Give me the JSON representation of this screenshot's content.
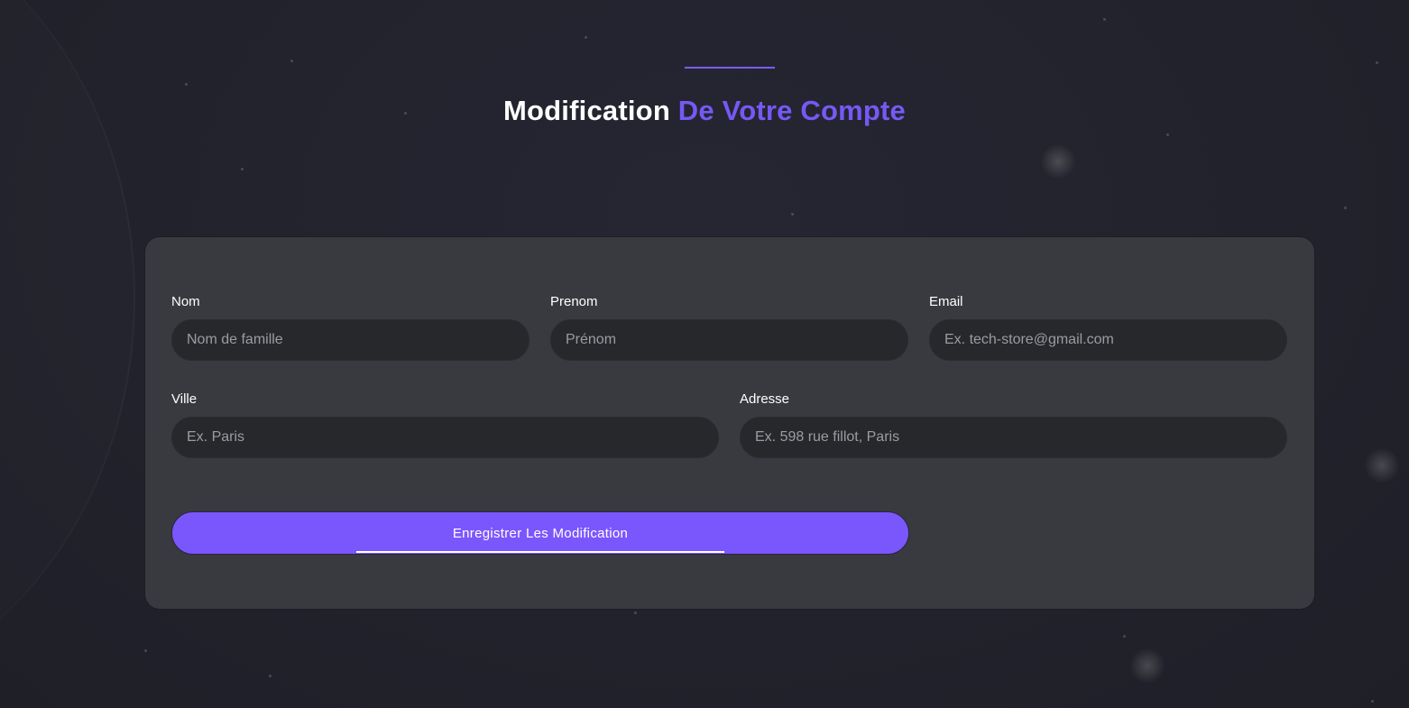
{
  "header": {
    "title_main": "Modification",
    "title_accent": "De Votre Compte"
  },
  "form": {
    "fields": [
      {
        "label": "Nom",
        "placeholder": "Nom de famille",
        "value": ""
      },
      {
        "label": "Prenom",
        "placeholder": "Prénom",
        "value": ""
      },
      {
        "label": "Email",
        "placeholder": "Ex. tech-store@gmail.com",
        "value": ""
      },
      {
        "label": "Ville",
        "placeholder": "Ex. Paris",
        "value": ""
      },
      {
        "label": "Adresse",
        "placeholder": "Ex. 598 rue fillot, Paris",
        "value": ""
      }
    ],
    "submit_label": "Enregistrer Les Modification"
  },
  "colors": {
    "accent": "#7659f5",
    "button": "#7a57fd",
    "background": "#22222d",
    "card": "#393a3f",
    "input": "#26282c"
  }
}
